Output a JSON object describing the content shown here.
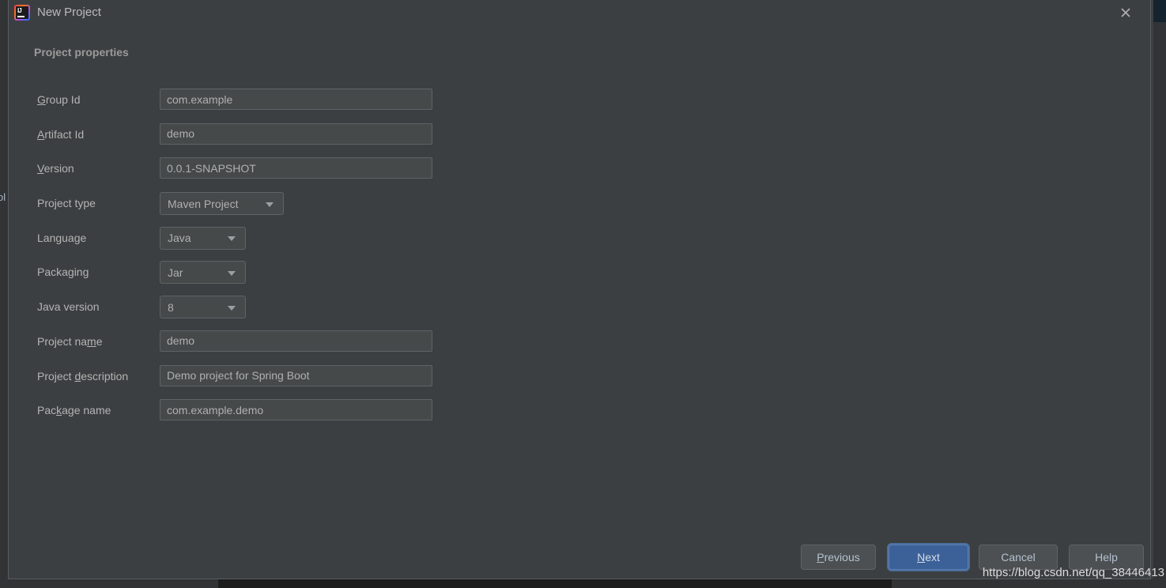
{
  "window": {
    "title": "New Project",
    "icon": "intellij-idea-logo",
    "close_icon": "close-icon"
  },
  "section": {
    "header": "Project properties"
  },
  "form": {
    "rows": [
      {
        "label_pre": "",
        "label_mnemonic": "G",
        "label_post": "roup Id",
        "type": "text",
        "value": "com.example",
        "name": "group-id"
      },
      {
        "label_pre": "",
        "label_mnemonic": "A",
        "label_post": "rtifact Id",
        "type": "text",
        "value": "demo",
        "name": "artifact-id"
      },
      {
        "label_pre": "",
        "label_mnemonic": "V",
        "label_post": "ersion",
        "type": "text",
        "value": "0.0.1-SNAPSHOT",
        "name": "version"
      },
      {
        "label_pre": "Project type",
        "label_mnemonic": "",
        "label_post": "",
        "type": "combo-wide",
        "value": "Maven Project",
        "name": "project-type"
      },
      {
        "label_pre": "Language",
        "label_mnemonic": "",
        "label_post": "",
        "type": "combo-small",
        "value": "Java",
        "name": "language"
      },
      {
        "label_pre": "Packaging",
        "label_mnemonic": "",
        "label_post": "",
        "type": "combo-small",
        "value": "Jar",
        "name": "packaging"
      },
      {
        "label_pre": "Java version",
        "label_mnemonic": "",
        "label_post": "",
        "type": "combo-small",
        "value": "8",
        "name": "java-version"
      },
      {
        "label_pre": "Project na",
        "label_mnemonic": "m",
        "label_post": "e",
        "type": "text",
        "value": "demo",
        "name": "project-name"
      },
      {
        "label_pre": "Project ",
        "label_mnemonic": "d",
        "label_post": "escription",
        "type": "text",
        "value": "Demo project for Spring Boot",
        "name": "project-description"
      },
      {
        "label_pre": "Pac",
        "label_mnemonic": "k",
        "label_post": "age name",
        "type": "text",
        "value": "com.example.demo",
        "name": "package-name"
      }
    ]
  },
  "buttons": {
    "previous": {
      "pre": "",
      "mnemonic": "P",
      "post": "revious"
    },
    "next": {
      "pre": "",
      "mnemonic": "N",
      "post": "ext"
    },
    "cancel": {
      "pre": "Cancel",
      "mnemonic": "",
      "post": ""
    },
    "help": {
      "pre": "Help",
      "mnemonic": "",
      "post": ""
    }
  },
  "watermark": {
    "text": "https://blog.csdn.net/qq_38446413"
  },
  "background": {
    "left_text": "ol"
  },
  "colors": {
    "dialog_bg": "#3c3f41",
    "field_bg": "#45494a",
    "field_border": "#5e6366",
    "text": "#b4b4b4",
    "default_button_bg": "#3c6198",
    "default_button_border": "#5b7fb5"
  }
}
